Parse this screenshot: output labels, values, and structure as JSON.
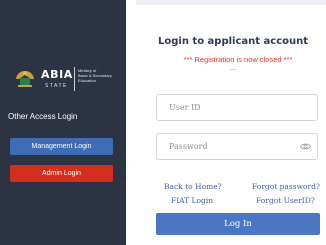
{
  "left_panel": {
    "logo": {
      "name": "ABIA",
      "subtitle": "STATE",
      "ministry_lines": [
        "Ministry of",
        "Basic & Secondary",
        "Education"
      ]
    },
    "other_access_label": "Other Access Login",
    "management_login_label": "Management Login",
    "admin_login_label": "Admin Login"
  },
  "form": {
    "title": "Login to applicant account",
    "notice": "*** Registration is now closed ***",
    "ellipsis": "...",
    "user_id_placeholder": "User ID",
    "password_placeholder": "Password",
    "links": {
      "back_home": "Back to Home?",
      "forgot_password": "Forgot password?",
      "fiat_login": "FIAT Login",
      "forgot_userid": "Forgot UserID?"
    },
    "login_button": "Log In"
  },
  "colors": {
    "sidebar_bg": "#2c3343",
    "management_button": "#3e6cb6",
    "admin_button": "#d22f1f",
    "notice_red": "#e3342f",
    "link_blue": "#3a5fa8",
    "login_button": "#4a76c4"
  },
  "icons": {
    "crest": "state-crest-icon",
    "password_toggle": "eye-icon"
  }
}
